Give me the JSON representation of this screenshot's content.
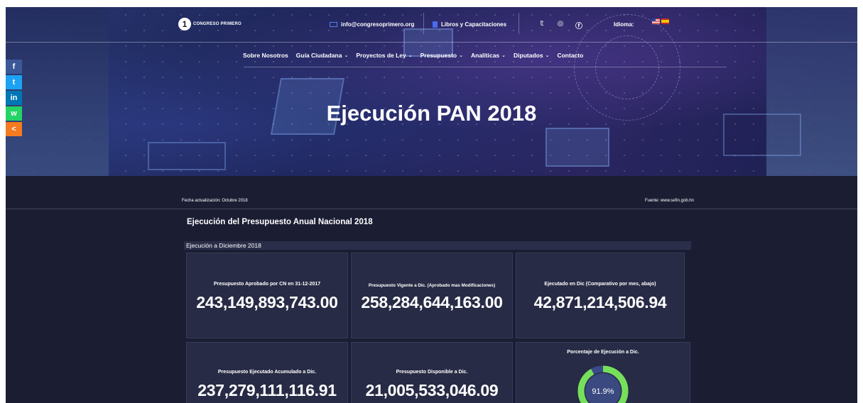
{
  "header": {
    "logo_symbol": "1",
    "logo_text": "CONGRESO PRIMERO",
    "email": "info@congresoprimero.org",
    "books_link": "Libros y Capacitaciones",
    "social_icons": [
      "twitter-icon",
      "instagram-icon",
      "facebook-icon"
    ],
    "idioma_label": "Idioma:",
    "languages": [
      "English",
      "Español"
    ]
  },
  "nav": {
    "items": [
      {
        "label": "Sobre Nosotros",
        "dropdown": false
      },
      {
        "label": "Guía Ciudadana",
        "dropdown": true
      },
      {
        "label": "Proyectos de Ley",
        "dropdown": true
      },
      {
        "label": "Presupuesto",
        "dropdown": true
      },
      {
        "label": "Analíticas",
        "dropdown": true
      },
      {
        "label": "Diputados",
        "dropdown": true
      },
      {
        "label": "Contacto",
        "dropdown": false
      }
    ],
    "chevron": "⌄"
  },
  "hero": {
    "title": "Ejecución PAN 2018"
  },
  "share_sidebar": {
    "buttons": [
      {
        "name": "facebook",
        "glyph": "f",
        "color": "#3b5998"
      },
      {
        "name": "twitter",
        "glyph": "t",
        "color": "#1da1f2"
      },
      {
        "name": "linkedin",
        "glyph": "in",
        "color": "#0077b5"
      },
      {
        "name": "whatsapp",
        "glyph": "w",
        "color": "#25d366"
      },
      {
        "name": "share",
        "glyph": "<",
        "color": "#f47b20"
      }
    ]
  },
  "content": {
    "fecha": "Fecha actualización: Octubre 2018",
    "fuente": "Fuente: www.sefin.gob.hn",
    "section_title": "Ejecución del Presupuesto Anual Nacional 2018",
    "subsection": "Ejecución a Diciembre 2018",
    "cards": [
      {
        "label": "Presupuesto Aprobado por CN en 31-12-2017",
        "value": "243,149,893,743.00"
      },
      {
        "label": "Presupuesto Vigente a Dic. (Aprobado mas Modificaciones)",
        "value": "258,284,644,163.00"
      },
      {
        "label": "Ejecutado en Dic (Comparativo por mes, abajo)",
        "value": "42,871,214,506.94"
      },
      {
        "label": "Presupuesto Ejecutado Acumulado a Dic.",
        "value": "237,279,111,116.91"
      },
      {
        "label": "Presupuesto Disponible a Dic.",
        "value": "21,005,533,046.09"
      }
    ],
    "gauge": {
      "label": "Porcentaje de Ejecución a Dic.",
      "value_text": "91.9%",
      "fraction": 0.919,
      "color_fill": "#76e05a",
      "color_track": "#3b4a8a"
    }
  }
}
